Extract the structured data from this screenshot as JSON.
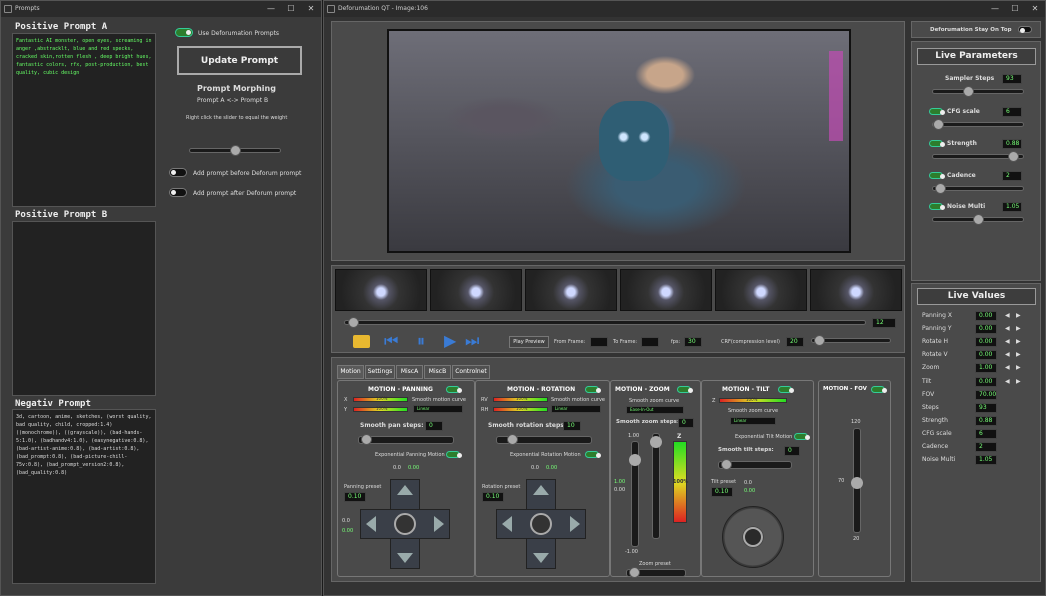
{
  "prompts_window": {
    "title": "Prompts",
    "positive_a_header": "Positive Prompt A",
    "positive_a_text": "Fantastic AI monster, open eyes, screaming in anger ,abstracklt, blue and red specks, cracked skin,rotten flesh , deep bright hues, fantastic colors, rfx, post-production, best quality, cubic design",
    "positive_b_header": "Positive Prompt B",
    "positive_b_text": "",
    "negative_header": "Negativ Prompt",
    "negative_text": "3d, cartoon, anime, sketches, (worst quality, bad quality, child, cropped:1.4) ((monochrome)), ((grayscale)), (bad-hands-5:1.0), (badhandv4:1.0), (easynegative:0.8), (bad-artist-anime:0.8), (bad-artist:0.8), (bad_prompt:0.8), (bad-picture-chill-75v:0.8), (bad_prompt_version2:0.8), (bad_quality:0.8)",
    "use_deforumation_label": "Use Deforumation Prompts",
    "update_button": "Update Prompt",
    "morphing_title": "Prompt Morphing",
    "morphing_subtitle": "Prompt A <-> Prompt B",
    "morphing_hint": "Right click the slider to equal the weight",
    "add_before_label": "Add prompt before Deforum prompt",
    "add_after_label": "Add prompt after Deforum prompt"
  },
  "main_window": {
    "title": "Deforumation QT - Image:106",
    "frame_counter": "12",
    "play_preview": "Play Preview",
    "from_frame": "From Frame:",
    "to_frame": "To Frame:",
    "fps_label": "fps:",
    "fps_value": "30",
    "crf_label": "CRF(compression level)",
    "crf_value": "20",
    "tabs": [
      "Motion",
      "Settings",
      "MiscA",
      "MiscB",
      "Controlnet"
    ],
    "panning": {
      "title": "MOTION - PANNING",
      "x_label": "X",
      "y_label": "Y",
      "bar_x": "100%",
      "bar_y": "100%",
      "smooth_curve": "Smooth motion curve",
      "curve_value": "Linear",
      "pan_steps": "Smooth pan steps:",
      "pan_steps_val": "0",
      "exp_label": "Exponential Panning Motion",
      "preset": "Panning preset",
      "preset_val": "0.10",
      "top_a": "0.0",
      "top_b": "0.00",
      "left_a": "0.0",
      "left_b": "0.00"
    },
    "rotation": {
      "title": "MOTION - ROTATION",
      "x_label": "RV",
      "y_label": "RH",
      "bar_x": "100%",
      "bar_y": "100%",
      "smooth_curve": "Smooth motion curve",
      "curve_value": "Linear",
      "rot_steps": "Smooth rotation steps:",
      "rot_steps_val": "10",
      "exp_label": "Exponential Rotation Motion",
      "preset": "Rotation preset",
      "preset_val": "0.10",
      "top_a": "0.0",
      "top_b": "0.00"
    },
    "zoom": {
      "title": "MOTION - ZOOM",
      "smooth_curve": "Smooth zoom curve",
      "curve_value": "Ease-In-Out",
      "steps": "Smooth zoom steps:",
      "steps_val": "0",
      "max": "1.00",
      "min": "-1.00",
      "mid": "1.00",
      "mid2": "0.00",
      "z_label": "Z",
      "pct": "100%",
      "preset": "Zoom preset"
    },
    "tilt": {
      "title": "MOTION - TILT",
      "z_label": "Z",
      "bar": "100%",
      "smooth_curve": "Smooth zoom curve",
      "curve_value": "Linear",
      "exp_label": "Exponential Tilt Motion",
      "steps": "Smooth tilt steps:",
      "steps_val": "0",
      "preset": "Tilt preset",
      "preset_val": "0.10",
      "a": "0.0",
      "b": "0.00"
    },
    "fov": {
      "title": "MOTION - FOV",
      "max": "120",
      "val": "70",
      "min": "20"
    }
  },
  "right_panel": {
    "stay_on_top": "Deforumation Stay On Top",
    "live_params_title": "Live Parameters",
    "params": [
      {
        "label": "Sampler Steps",
        "value": "93",
        "toggle": false
      },
      {
        "label": "CFG scale",
        "value": "6",
        "toggle": true
      },
      {
        "label": "Strength",
        "value": "0.88",
        "toggle": true
      },
      {
        "label": "Cadence",
        "value": "2",
        "toggle": true
      },
      {
        "label": "Noise Multi",
        "value": "1.05",
        "toggle": true
      }
    ],
    "live_values_title": "Live Values",
    "values": [
      {
        "label": "Panning X",
        "value": "0.00"
      },
      {
        "label": "Panning Y",
        "value": "0.00"
      },
      {
        "label": "Rotate H",
        "value": "0.00"
      },
      {
        "label": "Rotate V",
        "value": "0.00"
      },
      {
        "label": "Zoom",
        "value": "1.00"
      },
      {
        "label": "Tilt",
        "value": "0.00"
      },
      {
        "label": "FOV",
        "value": "70.00"
      },
      {
        "label": "Steps",
        "value": "93"
      },
      {
        "label": "Strength",
        "value": "0.88"
      },
      {
        "label": "CFG scale",
        "value": "6"
      },
      {
        "label": "Cadence",
        "value": "2"
      },
      {
        "label": "Noise Multi",
        "value": "1.05"
      }
    ]
  },
  "colors": {
    "accent_green": "#7f7",
    "toggle_on": "#2d7d2d",
    "play_blue": "#3a7bd5",
    "folder": "#e8b830"
  }
}
